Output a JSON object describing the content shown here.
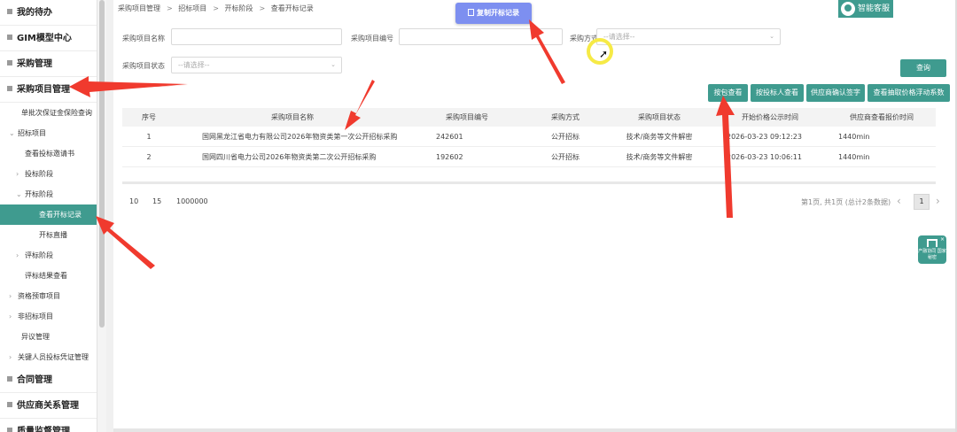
{
  "sidebar": {
    "items": [
      {
        "type": "group",
        "label": "我的待办"
      },
      {
        "type": "group",
        "label": "GIM模型中心"
      },
      {
        "type": "group",
        "label": "采购管理"
      },
      {
        "type": "group",
        "label": "采购项目管理"
      },
      {
        "type": "item",
        "label": "单批次保证金保险查询",
        "indent": 1
      },
      {
        "type": "item",
        "label": "招标项目",
        "indent": 1,
        "caret": "v"
      },
      {
        "type": "item",
        "label": "查看投标邀请书",
        "indent": 2
      },
      {
        "type": "item",
        "label": "投标阶段",
        "indent": 2,
        "caret": ">"
      },
      {
        "type": "item",
        "label": "开标阶段",
        "indent": 2,
        "caret": "v"
      },
      {
        "type": "item",
        "label": "查看开标记录",
        "indent": 3,
        "active": true
      },
      {
        "type": "item",
        "label": "开标直播",
        "indent": 3
      },
      {
        "type": "item",
        "label": "评标阶段",
        "indent": 2,
        "caret": ">"
      },
      {
        "type": "item",
        "label": "评标结果查看",
        "indent": 2
      },
      {
        "type": "item",
        "label": "资格预审项目",
        "indent": 1,
        "caret": ">"
      },
      {
        "type": "item",
        "label": "非招标项目",
        "indent": 1,
        "caret": ">"
      },
      {
        "type": "item",
        "label": "异议管理",
        "indent": 1
      },
      {
        "type": "item",
        "label": "关键人员投标凭证管理",
        "indent": 1,
        "caret": ">"
      },
      {
        "type": "group",
        "label": "合同管理"
      },
      {
        "type": "group",
        "label": "供应商关系管理"
      },
      {
        "type": "group",
        "label": "质量监督管理"
      }
    ]
  },
  "breadcrumb": [
    "采购项目管理",
    "招标项目",
    "开标阶段",
    "查看开标记录"
  ],
  "top_button": {
    "label": "复制开标记录",
    "icon": "clipboard-icon"
  },
  "service": {
    "label": "智能客服",
    "icon": "avatar-icon"
  },
  "filters": {
    "name_label": "采购项目名称",
    "code_label": "采购项目编号",
    "method_label": "采购方式",
    "method_placeholder": "--请选择--",
    "status_label": "采购项目状态",
    "status_placeholder": "--请选择--"
  },
  "buttons": {
    "search": "查询",
    "by_package": "按包查看",
    "by_bidder": "按投标人查看",
    "supplier_confirm": "供应商确认签字",
    "price_float": "查看抽取价格浮动系数"
  },
  "table": {
    "headers": [
      "序号",
      "采购项目名称",
      "采购项目编号",
      "采购方式",
      "采购项目状态",
      "开始价格公示时间",
      "供应商查看报价时间"
    ],
    "rows": [
      [
        "1",
        "国网黑龙江省电力有限公司2026年物资类第一次公开招标采购",
        "242601",
        "公开招标",
        "技术/商务等文件解密",
        "2026-03-23 09:12:23",
        "1440min"
      ],
      [
        "2",
        "国网四川省电力公司2026年物资类第二次公开招标采购",
        "192602",
        "公开招标",
        "技术/商务等文件解密",
        "2026-03-23 10:06:11",
        "1440min"
      ]
    ]
  },
  "pagination": {
    "sizes": [
      "10",
      "15",
      "1000000"
    ],
    "info": "第1页, 共1页 (总计2条数据)",
    "current": "1",
    "prev": "‹",
    "next": "›"
  },
  "float_badge": {
    "label": "产融协同 国家秘密",
    "close": "×"
  },
  "colors": {
    "accent": "#3f9b8f",
    "top_button": "#7d8ff0",
    "arrow": "#f03a2e",
    "cursor_ring": "#f6ea46"
  }
}
